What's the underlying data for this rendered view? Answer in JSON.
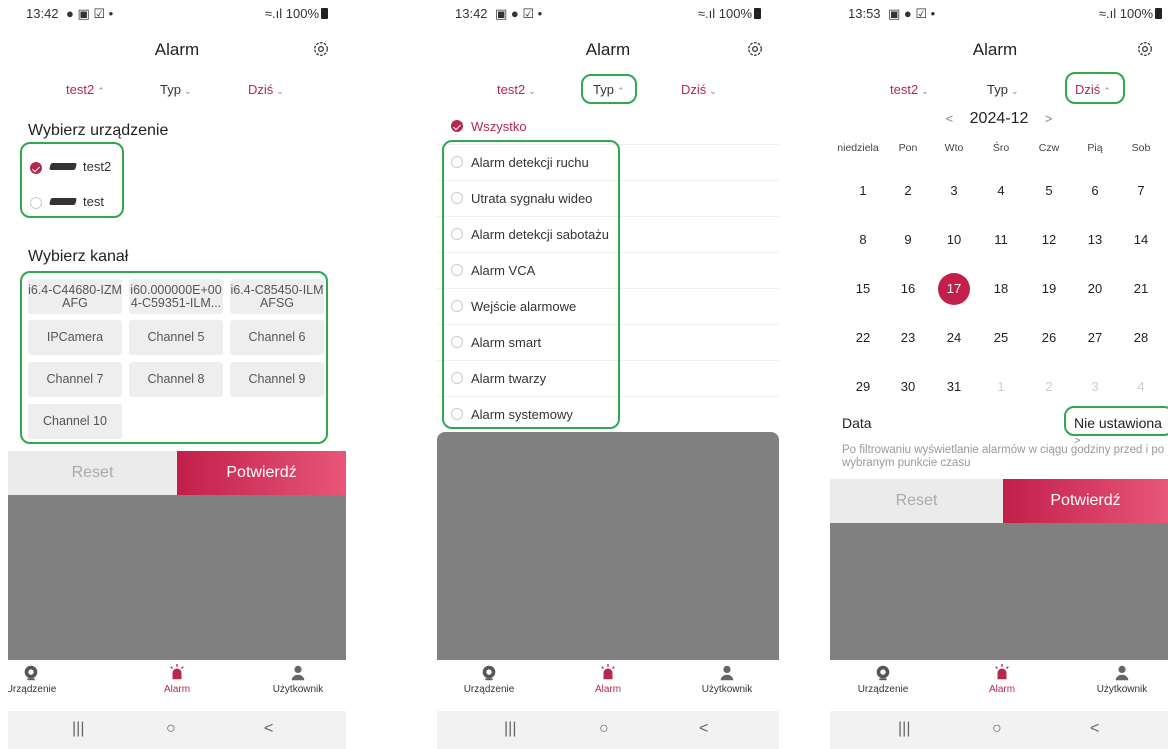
{
  "status": {
    "p1": {
      "time": "13:42",
      "battery": "100%"
    },
    "p2": {
      "time": "13:42",
      "battery": "100%"
    },
    "p3": {
      "time": "13:53",
      "battery": "100%"
    }
  },
  "title": "Alarm",
  "filters": {
    "device": "test2",
    "type": "Typ",
    "date": "Dziś"
  },
  "device_section": {
    "title": "Wybierz urządzenie",
    "devices": [
      {
        "name": "test2",
        "selected": true
      },
      {
        "name": "test",
        "selected": false
      }
    ]
  },
  "channel_section": {
    "title": "Wybierz kanał",
    "channels": [
      "i6.4-C44680-IZM AFG",
      "i60.000000E+00 4-C59351-ILM...",
      "i6.4-C85450-ILM AFSG",
      "IPCamera",
      "Channel 5",
      "Channel 6",
      "Channel 7",
      "Channel 8",
      "Channel 9",
      "Channel 10"
    ]
  },
  "buttons": {
    "reset": "Reset",
    "confirm": "Potwierdź"
  },
  "types": {
    "all": "Wszystko",
    "items": [
      "Alarm detekcji ruchu",
      "Utrata sygnału wideo",
      "Alarm detekcji sabotażu",
      "Alarm VCA",
      "Wejście alarmowe",
      "Alarm smart",
      "Alarm twarzy",
      "Alarm systemowy"
    ]
  },
  "calendar": {
    "month": "2024-12",
    "prev": "<",
    "next": ">",
    "weekdays": [
      "niedziela",
      "Pon",
      "Wto",
      "Śro",
      "Czw",
      "Pią",
      "Sob"
    ],
    "weeks": [
      [
        "1",
        "2",
        "3",
        "4",
        "5",
        "6",
        "7"
      ],
      [
        "8",
        "9",
        "10",
        "11",
        "12",
        "13",
        "14"
      ],
      [
        "15",
        "16",
        "17",
        "18",
        "19",
        "20",
        "21"
      ],
      [
        "22",
        "23",
        "24",
        "25",
        "26",
        "27",
        "28"
      ],
      [
        "29",
        "30",
        "31",
        "1",
        "2",
        "3",
        "4"
      ]
    ],
    "selected_day": "17",
    "data_label": "Data",
    "data_value": "Nie ustawiona",
    "note": "Po filtrowaniu wyświetlanie alarmów w ciągu godziny przed i po wybranym punkcie czasu"
  },
  "tabs": {
    "device": "Urządzenie",
    "alarm": "Alarm",
    "user": "Użytkownik"
  },
  "nav": {
    "recent": "|||",
    "home": "○",
    "back": "<"
  },
  "colors": {
    "accent": "#b5294e",
    "highlight": "#2fa84f",
    "overlay": "#808080"
  }
}
